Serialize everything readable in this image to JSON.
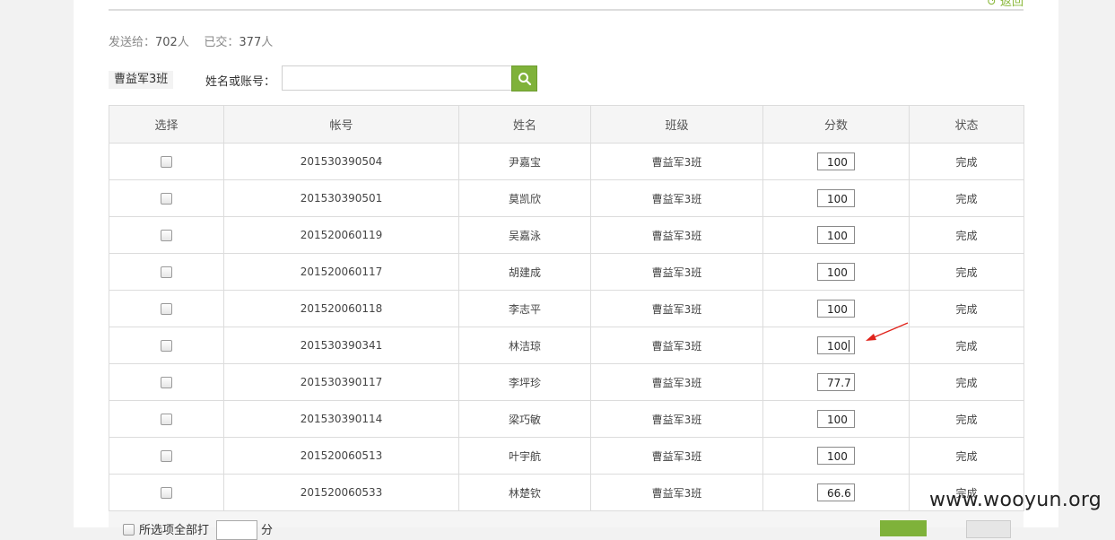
{
  "header": {
    "back_link": "返回",
    "stats_sent_label": "发送给：",
    "stats_sent_value": "702",
    "stats_sent_unit": "人",
    "stats_done_label": "已交：",
    "stats_done_value": "377",
    "stats_done_unit": "人"
  },
  "filter": {
    "class_tag": "曹益军3班",
    "search_label": "姓名或账号：",
    "search_value": "",
    "search_icon": "search-icon"
  },
  "table": {
    "headers": [
      "选择",
      "帐号",
      "姓名",
      "班级",
      "分数",
      "状态"
    ],
    "rows": [
      {
        "account": "201530390504",
        "name": "尹嘉宝",
        "class": "曹益军3班",
        "score": "100",
        "status": "完成"
      },
      {
        "account": "201530390501",
        "name": "莫凯欣",
        "class": "曹益军3班",
        "score": "100",
        "status": "完成"
      },
      {
        "account": "201520060119",
        "name": "吴嘉泳",
        "class": "曹益军3班",
        "score": "100",
        "status": "完成"
      },
      {
        "account": "201520060117",
        "name": "胡建成",
        "class": "曹益军3班",
        "score": "100",
        "status": "完成"
      },
      {
        "account": "201520060118",
        "name": "李志平",
        "class": "曹益军3班",
        "score": "100",
        "status": "完成"
      },
      {
        "account": "201530390341",
        "name": "林洁琼",
        "class": "曹益军3班",
        "score": "100",
        "status": "完成"
      },
      {
        "account": "201530390117",
        "name": "李坪珍",
        "class": "曹益军3班",
        "score": "77.7",
        "status": "完成"
      },
      {
        "account": "201530390114",
        "name": "梁巧敏",
        "class": "曹益军3班",
        "score": "100",
        "status": "完成"
      },
      {
        "account": "201520060513",
        "name": "叶宇航",
        "class": "曹益军3班",
        "score": "100",
        "status": "完成"
      },
      {
        "account": "201520060533",
        "name": "林楚钦",
        "class": "曹益军3班",
        "score": "66.6",
        "status": "完成"
      }
    ]
  },
  "bottom": {
    "select_all_text": "所选项全部打",
    "unit": "分"
  },
  "watermark": "www.wooyun.org",
  "colors": {
    "accent_green": "#7fb23a",
    "arrow_red": "#e0231b"
  }
}
